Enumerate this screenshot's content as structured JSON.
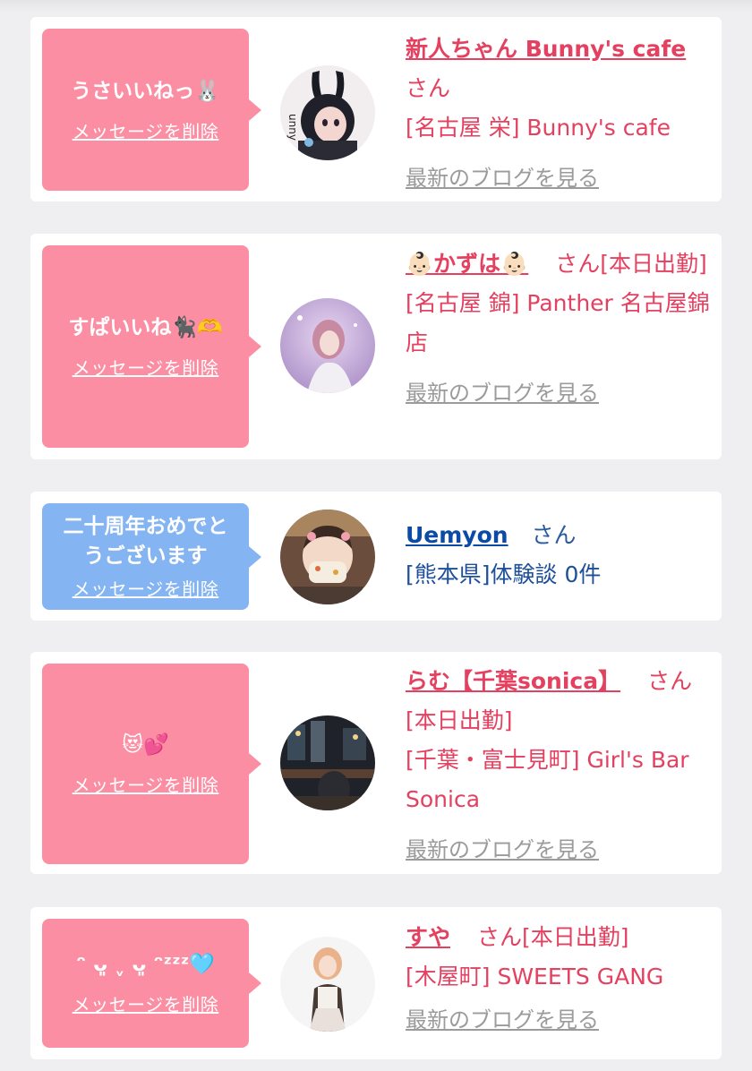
{
  "cards": [
    {
      "message": "うさいいねっ🐰",
      "delete_label": "メッセージを削除",
      "name": "新人ちゃん Bunny's cafe",
      "san": "さん",
      "shop": "[名古屋 栄] Bunny's cafe",
      "blog_label": "最新のブログを見る"
    },
    {
      "message": "すぱいいね🐈‍⬛🫶",
      "delete_label": "メッセージを削除",
      "name": "👶🏻かずは👶🏻",
      "san": "さん",
      "status": "[本日出勤]",
      "shop": "[名古屋 錦] Panther 名古屋錦店",
      "blog_label": "最新のブログを見る"
    },
    {
      "message": "二十周年おめでとうございます",
      "delete_label": "メッセージを削除",
      "name": "Uemyon",
      "san": "さん",
      "shop": "[熊本県]体験談 0件"
    },
    {
      "message": "😻💕",
      "delete_label": "メッセージを削除",
      "name": "らむ【千葉sonica】",
      "san": "さん",
      "status": "[本日出勤]",
      "shop": "[千葉・富士見町] Girl's Bar Sonica",
      "blog_label": "最新のブログを見る"
    },
    {
      "message": "ᵔ ᴗ͈ ˬ ᴗ͈ ᵔᶻᶻᶻ🩵",
      "delete_label": "メッセージを削除",
      "name": "すや",
      "san": "さん",
      "status": "[本日出勤]",
      "shop": "[木屋町] SWEETS GANG",
      "blog_label": "最新のブログを見る"
    }
  ],
  "colors": {
    "pink_bubble": "#fc8ea3",
    "blue_bubble": "#84b5f2",
    "accent": "#e4405f",
    "link_blue": "#0b4aa5"
  }
}
